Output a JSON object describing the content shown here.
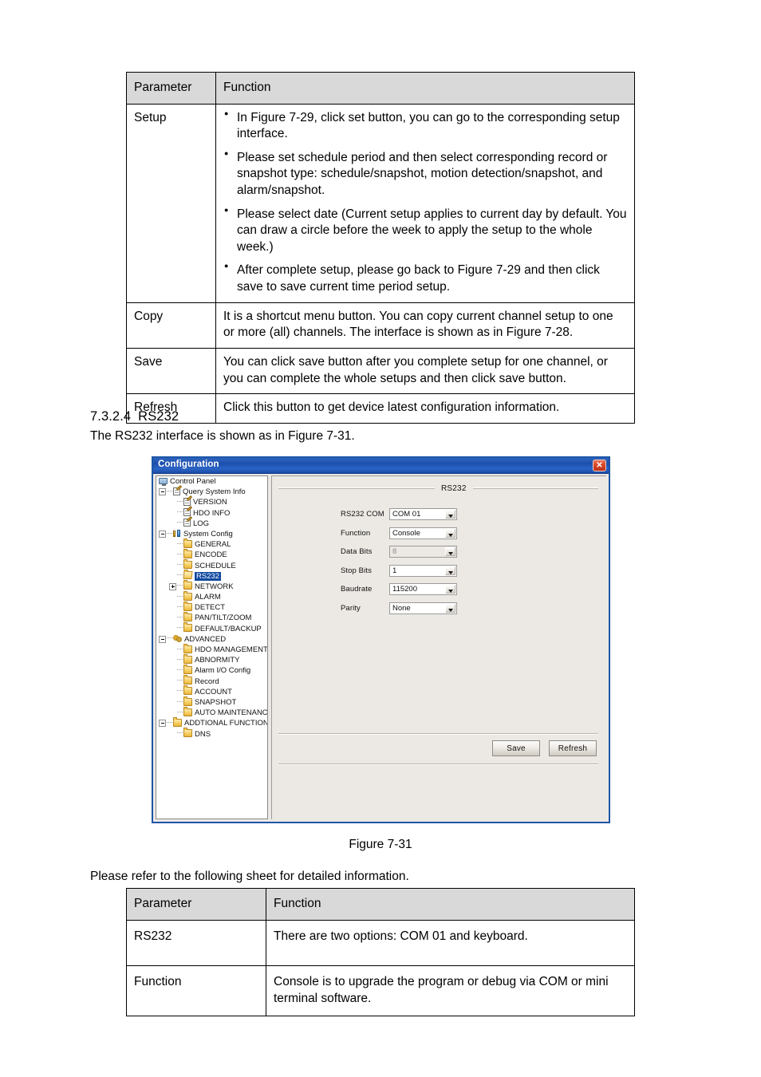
{
  "table_one": {
    "headers": [
      "Parameter",
      "Function"
    ],
    "rows": [
      {
        "parameter": "Setup",
        "bullets": [
          "In Figure 7-29, click set button, you can go to the corresponding setup interface.",
          "Please set schedule period and then select corresponding record or snapshot type: schedule/snapshot, motion detection/snapshot, and alarm/snapshot.",
          "Please select date (Current setup applies to current day by default. You can draw a circle before the week to apply the setup to the whole week.)",
          "After complete setup, please go back to Figure 7-29 and then click save to save current time period setup."
        ]
      },
      {
        "parameter": "Copy",
        "text": "It is a shortcut menu button. You can copy current channel setup to one or more (all) channels.  The interface is shown as in Figure 7-28."
      },
      {
        "parameter": "Save",
        "text": "You can click save button after you complete setup for one channel, or you can complete the whole setups and then click save button."
      },
      {
        "parameter": "Refresh",
        "text": "Click this button to get device latest configuration information."
      }
    ]
  },
  "section": {
    "number": "7.3.2.4",
    "title": "RS232",
    "intro": "The RS232 interface is shown as in Figure 7-31."
  },
  "figure": {
    "caption": "Figure 7-31"
  },
  "sheet_intro": "Please refer to the following sheet for detailed information.",
  "table_two": {
    "headers": [
      "Parameter",
      "Function"
    ],
    "rows": [
      {
        "parameter": "RS232",
        "text": "There are two options: COM 01 and keyboard."
      },
      {
        "parameter": "Function",
        "text": "Console is to upgrade the program or debug via COM or mini terminal software."
      }
    ]
  },
  "dialog": {
    "title": "Configuration",
    "close_label": "✕",
    "accent_color": "#1d55a8",
    "selection_color": "#1149a0",
    "tree": [
      {
        "label": "Control Panel",
        "indent": 0,
        "icon": "monitor-icon",
        "expander": "none",
        "selected": false
      },
      {
        "label": "Query System Info",
        "indent": 0,
        "icon": "note-icon",
        "expander": "minus",
        "selected": false
      },
      {
        "label": "VERSION",
        "indent": 1,
        "icon": "note-icon",
        "expander": "leaf",
        "selected": false
      },
      {
        "label": "HDO INFO",
        "indent": 1,
        "icon": "note-icon",
        "expander": "leaf",
        "selected": false
      },
      {
        "label": "LOG",
        "indent": 1,
        "icon": "note-icon",
        "expander": "leaf",
        "selected": false
      },
      {
        "label": "System Config",
        "indent": 0,
        "icon": "sysconfig-icon",
        "expander": "minus",
        "selected": false
      },
      {
        "label": "GENERAL",
        "indent": 1,
        "icon": "folder-icon",
        "expander": "leaf",
        "selected": false
      },
      {
        "label": "ENCODE",
        "indent": 1,
        "icon": "folder-icon",
        "expander": "leaf",
        "selected": false
      },
      {
        "label": "SCHEDULE",
        "indent": 1,
        "icon": "folder-icon",
        "expander": "leaf",
        "selected": false
      },
      {
        "label": "RS232",
        "indent": 1,
        "icon": "folder-open-icon",
        "expander": "leaf",
        "selected": true
      },
      {
        "label": "NETWORK",
        "indent": 1,
        "icon": "folder-icon",
        "expander": "plus",
        "selected": false
      },
      {
        "label": "ALARM",
        "indent": 1,
        "icon": "folder-icon",
        "expander": "leaf",
        "selected": false
      },
      {
        "label": "DETECT",
        "indent": 1,
        "icon": "folder-icon",
        "expander": "leaf",
        "selected": false
      },
      {
        "label": "PAN/TILT/ZOOM",
        "indent": 1,
        "icon": "folder-icon",
        "expander": "leaf",
        "selected": false
      },
      {
        "label": "DEFAULT/BACKUP",
        "indent": 1,
        "icon": "folder-icon",
        "expander": "leaf",
        "selected": false
      },
      {
        "label": "ADVANCED",
        "indent": 0,
        "icon": "gears-icon",
        "expander": "minus",
        "selected": false
      },
      {
        "label": "HDO MANAGEMENT",
        "indent": 1,
        "icon": "folder-icon",
        "expander": "leaf",
        "selected": false
      },
      {
        "label": "ABNORMITY",
        "indent": 1,
        "icon": "folder-icon",
        "expander": "leaf",
        "selected": false
      },
      {
        "label": "Alarm I/O Config",
        "indent": 1,
        "icon": "folder-icon",
        "expander": "leaf",
        "selected": false
      },
      {
        "label": "Record",
        "indent": 1,
        "icon": "folder-icon",
        "expander": "leaf",
        "selected": false
      },
      {
        "label": "ACCOUNT",
        "indent": 1,
        "icon": "folder-icon",
        "expander": "leaf",
        "selected": false
      },
      {
        "label": "SNAPSHOT",
        "indent": 1,
        "icon": "folder-icon",
        "expander": "leaf",
        "selected": false
      },
      {
        "label": "AUTO MAINTENANCE",
        "indent": 1,
        "icon": "folder-icon",
        "expander": "leaf",
        "selected": false
      },
      {
        "label": "ADDTIONAL FUNCTION",
        "indent": 0,
        "icon": "folder-icon",
        "expander": "minus",
        "selected": false
      },
      {
        "label": "DNS",
        "indent": 1,
        "icon": "folder-icon",
        "expander": "leaf",
        "selected": false
      }
    ],
    "group_title": "RS232",
    "fields": [
      {
        "label": "RS232 COM",
        "value": "COM 01",
        "disabled": false
      },
      {
        "label": "Function",
        "value": "Console",
        "disabled": false
      },
      {
        "label": "Data Bits",
        "value": "8",
        "disabled": true
      },
      {
        "label": "Stop Bits",
        "value": "1",
        "disabled": false
      },
      {
        "label": "Baudrate",
        "value": "115200",
        "disabled": false
      },
      {
        "label": "Parity",
        "value": "None",
        "disabled": false
      }
    ],
    "buttons": {
      "save": "Save",
      "refresh": "Refresh"
    }
  }
}
